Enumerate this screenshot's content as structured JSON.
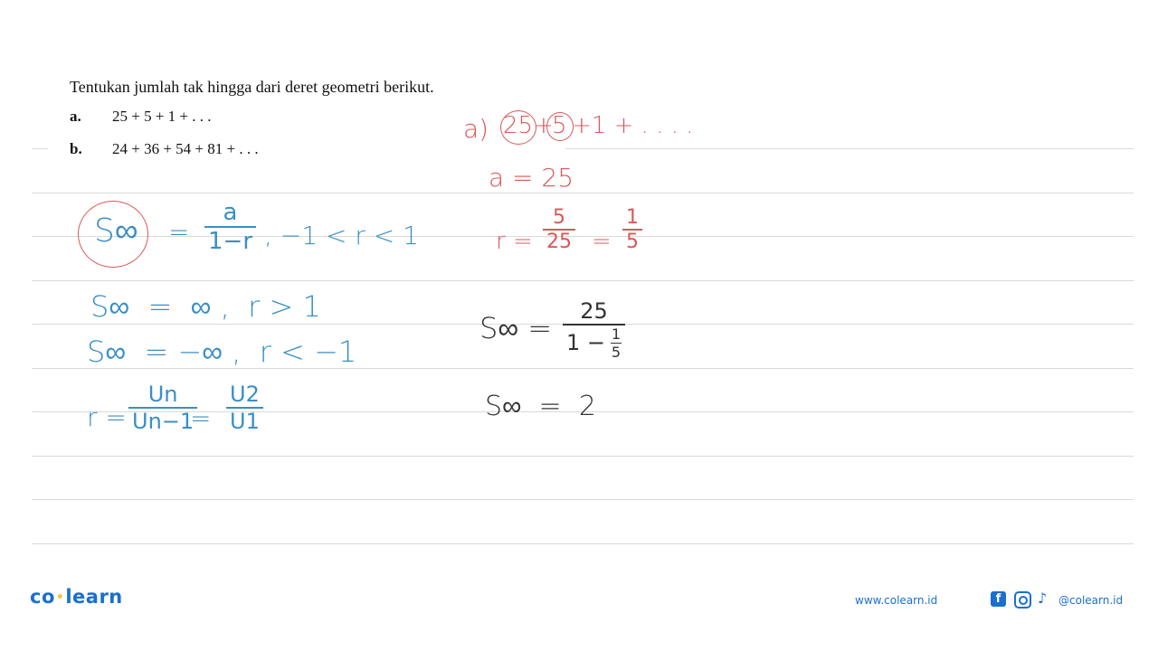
{
  "question": {
    "title": "Tentukan jumlah tak hingga dari deret geometri berikut.",
    "items": [
      {
        "label": "a.",
        "series": "25 + 5 + 1 + . . ."
      },
      {
        "label": "b.",
        "series": "24 + 36 + 54 + 81 + . . ."
      }
    ]
  },
  "notes_left": {
    "formula1": {
      "lhs": "S∞",
      "eq": "=",
      "num": "a",
      "den": "1−r",
      "cond": ", −1 < r < 1"
    },
    "formula2": {
      "text": "S∞  =  ∞ ,  r > 1"
    },
    "formula3": {
      "text": "S∞  = −∞ ,  r < −1"
    },
    "formula4": {
      "lhs": "r =",
      "num1": "Un",
      "den1": "Un−1",
      "eq": "=",
      "num2": "U2",
      "den2": "U1"
    }
  },
  "notes_right": {
    "part_label": "a)",
    "series_terms": [
      "25",
      "+",
      "5",
      "+1 + . . . ."
    ],
    "a_value": "a = 25",
    "ratio": {
      "lhs": "r =",
      "num1": "5",
      "den1": "25",
      "eq": "=",
      "num2": "1",
      "den2": "5"
    },
    "sum": {
      "lhs": "S∞ =",
      "num": "25",
      "den_prefix": "1 −",
      "den_num": "1",
      "den_den": "5"
    },
    "result": "S∞  =  2"
  },
  "colors": {
    "blue_ink": "#3a8fc4",
    "red_ink": "#d9585a",
    "black_ink": "#333333",
    "brand": "#1a6fd1"
  },
  "footer": {
    "logo_left": "co",
    "logo_right": "learn",
    "website": "www.colearn.id",
    "social_icons": [
      "facebook-icon",
      "instagram-icon",
      "tiktok-icon"
    ],
    "handle": "@colearn.id"
  }
}
